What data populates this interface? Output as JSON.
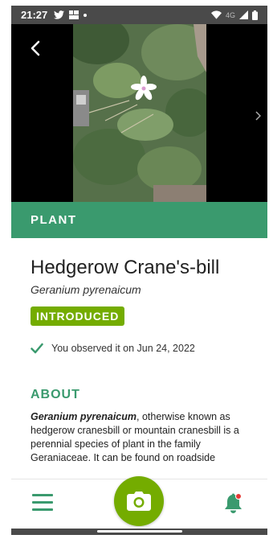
{
  "status_bar": {
    "time": "21:27",
    "network_label": "4G",
    "icons": [
      "twitter-icon",
      "app-icon",
      "dot-icon",
      "wifi-icon",
      "signal-icon",
      "battery-icon"
    ]
  },
  "hero": {
    "icons": [
      "back-arrow-icon",
      "chevron-right-icon"
    ]
  },
  "category": {
    "label": "PLANT",
    "color": "#3a9a6e"
  },
  "taxon": {
    "common_name": "Hedgerow Crane's-bill",
    "scientific_name": "Geranium pyrenaicum",
    "status_badge": "INTRODUCED",
    "badge_color": "#74ac00",
    "observed_text": "You observed it on Jun 24, 2022"
  },
  "about": {
    "heading": "ABOUT",
    "lead": "Geranium pyrenaicum",
    "body": ", otherwise known as hedgerow cranesbill or mountain cranesbill is a perennial species of plant in the family Geraniaceae. It can be found on roadside"
  },
  "bottom_nav": {
    "icons": [
      "menu-icon",
      "camera-icon",
      "bell-icon"
    ],
    "accent": "#3a9a6e",
    "notification_color": "#e53935"
  }
}
